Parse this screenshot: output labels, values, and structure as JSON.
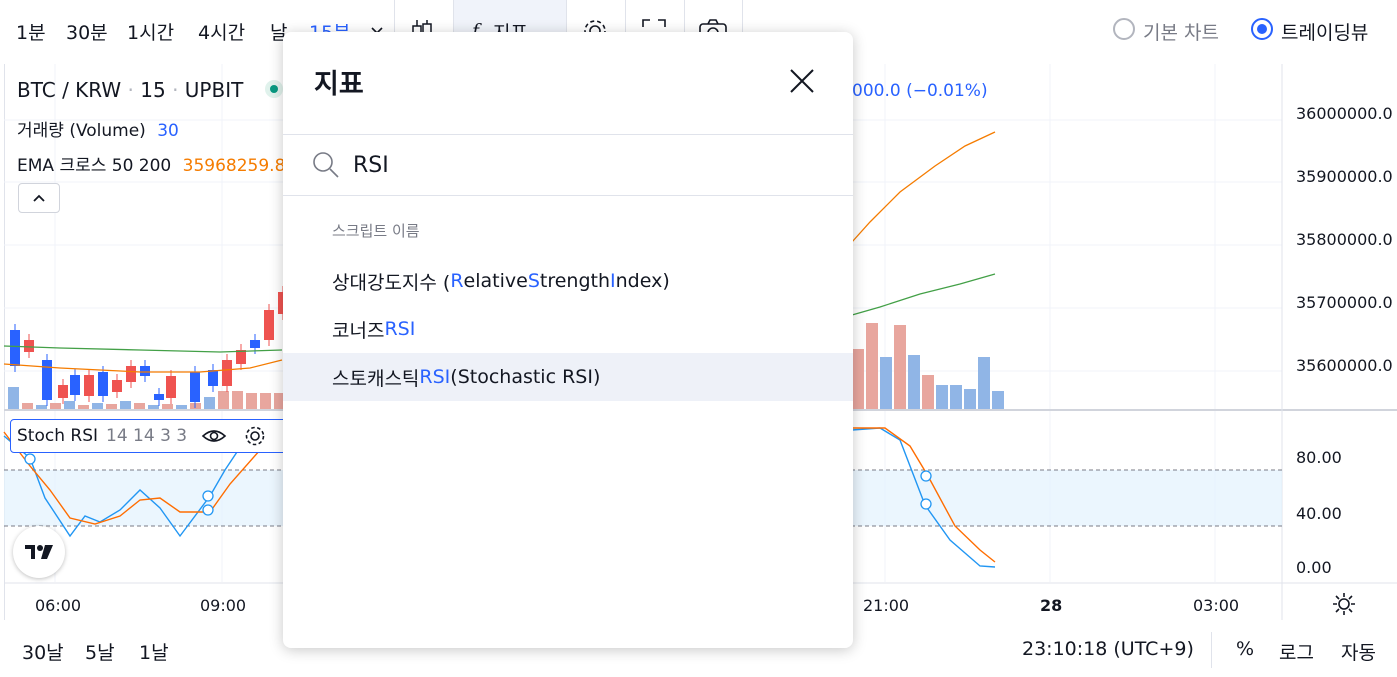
{
  "toolbar": {
    "intervals": [
      "1분",
      "30분",
      "1시간",
      "4시간",
      "날",
      "15분"
    ],
    "indicators_label": "지표",
    "chart_styles": [
      "기본 차트",
      "트레이딩뷰"
    ],
    "selected_style": "트레이딩뷰"
  },
  "legend": {
    "symbol": "BTC / KRW",
    "interval": "15",
    "exchange": "UPBIT",
    "change": "000.0 (−0.01%)",
    "volume_label": "거래량 (Volume)",
    "volume_value": "30",
    "ema_label": "EMA 크로스 50 200",
    "ema_value": "35968259.8"
  },
  "stoch_legend": {
    "name": "Stoch RSI",
    "params": "14 14 3 3"
  },
  "price_axis": [
    "36000000.0",
    "35900000.0",
    "35800000.0",
    "35700000.0",
    "35600000.0"
  ],
  "osc_axis": [
    "80.00",
    "40.00",
    "0.00"
  ],
  "time_axis": [
    "06:00",
    "09:00",
    "21:00",
    "28",
    "03:00"
  ],
  "bottom_bar": {
    "ranges": [
      "30날",
      "5날",
      "1날"
    ],
    "clock": "23:10:18 (UTC+9)",
    "percent": "%",
    "log": "로그",
    "auto": "자동"
  },
  "modal": {
    "title": "지표",
    "search_value": "RSI",
    "section": "스크립트 이름",
    "results": [
      {
        "prefix": "상대강도지수 (",
        "r": "R",
        "elative": "elative ",
        "s": "S",
        "trength": "trength ",
        "i": "I",
        "ndex": "ndex)"
      },
      {
        "prefix": "코너즈 ",
        "hit": "RSI"
      },
      {
        "prefix": "스토캐스틱 ",
        "hit": "RSI",
        "suffix": " (Stochastic RSI)"
      }
    ]
  },
  "colors": {
    "accent": "#2962ff",
    "up_candle": "#ef5350",
    "down_candle": "#2962ff",
    "ema_fast": "#f57c00",
    "ema_slow": "#43a047",
    "stoch_k": "#2196f3",
    "stoch_d": "#ff6d00"
  }
}
